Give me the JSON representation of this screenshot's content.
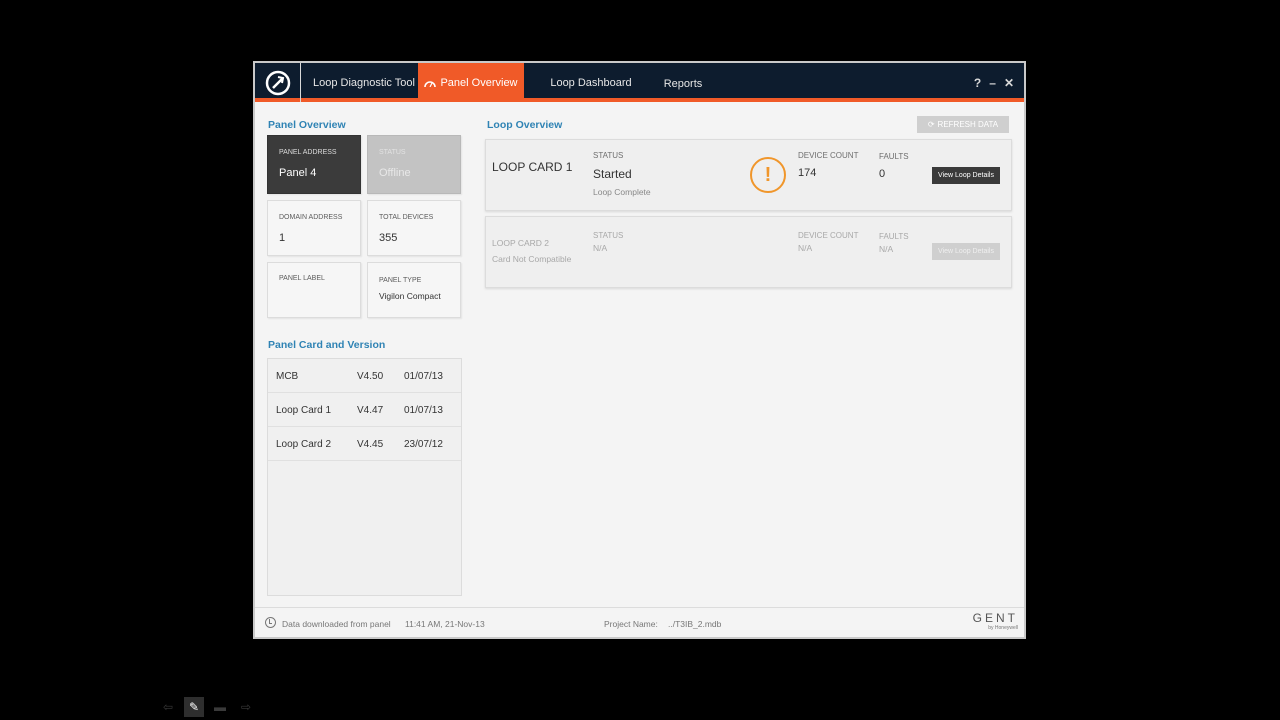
{
  "app": {
    "title": "Loop Diagnostic Tool",
    "tabs": [
      {
        "label": "Panel Overview",
        "active": true
      },
      {
        "label": "Loop Dashboard",
        "active": false
      },
      {
        "label": "Reports",
        "active": false
      }
    ],
    "controls": {
      "help": "?",
      "minimize": "–",
      "close": "✕"
    }
  },
  "panel_overview": {
    "title": "Panel Overview",
    "tiles": [
      {
        "caption": "PANEL ADDRESS",
        "value": "Panel 4"
      },
      {
        "caption": "STATUS",
        "value": "Offline"
      },
      {
        "caption": "DOMAIN ADDRESS",
        "value": "1"
      },
      {
        "caption": "TOTAL DEVICES",
        "value": "355"
      },
      {
        "caption": "PANEL LABEL",
        "value": ""
      },
      {
        "caption": "PANEL TYPE",
        "value": "Vigilon Compact"
      }
    ]
  },
  "panel_cards": {
    "title": "Panel Card and Version",
    "rows": [
      {
        "name": "MCB",
        "version": "V4.50",
        "date": "01/07/13"
      },
      {
        "name": "Loop Card 1",
        "version": "V4.47",
        "date": "01/07/13"
      },
      {
        "name": "Loop Card 2",
        "version": "V4.45",
        "date": "23/07/12"
      }
    ]
  },
  "loop_overview": {
    "title": "Loop Overview",
    "refresh_label": "REFRESH DATA",
    "cards": [
      {
        "name": "LOOP CARD 1",
        "status_caption": "STATUS",
        "status": "Started",
        "status_sub": "Loop Complete",
        "warning_icon": "!",
        "device_count_caption": "DEVICE COUNT",
        "device_count": "174",
        "faults_caption": "FAULTS",
        "faults": "0",
        "button": "View Loop Details"
      },
      {
        "name": "LOOP CARD 2",
        "name_sub": "Card Not Compatible",
        "status_caption": "STATUS",
        "status": "N/A",
        "device_count_caption": "DEVICE COUNT",
        "device_count": "N/A",
        "faults_caption": "FAULTS",
        "faults": "N/A",
        "button": "View Loop Details"
      }
    ]
  },
  "statusbar": {
    "downloaded": "Data downloaded from panel",
    "time": "11:41 AM, 21-Nov-13",
    "project_label": "Project Name:",
    "project_value": "../T3IB_2.mdb",
    "brand": "GENT",
    "brand_sub": "by Honeywell"
  },
  "colors": {
    "accent": "#f05a28",
    "titlebar": "#0d1c2e",
    "section_title": "#2f83b4",
    "warning": "#f0962b"
  }
}
